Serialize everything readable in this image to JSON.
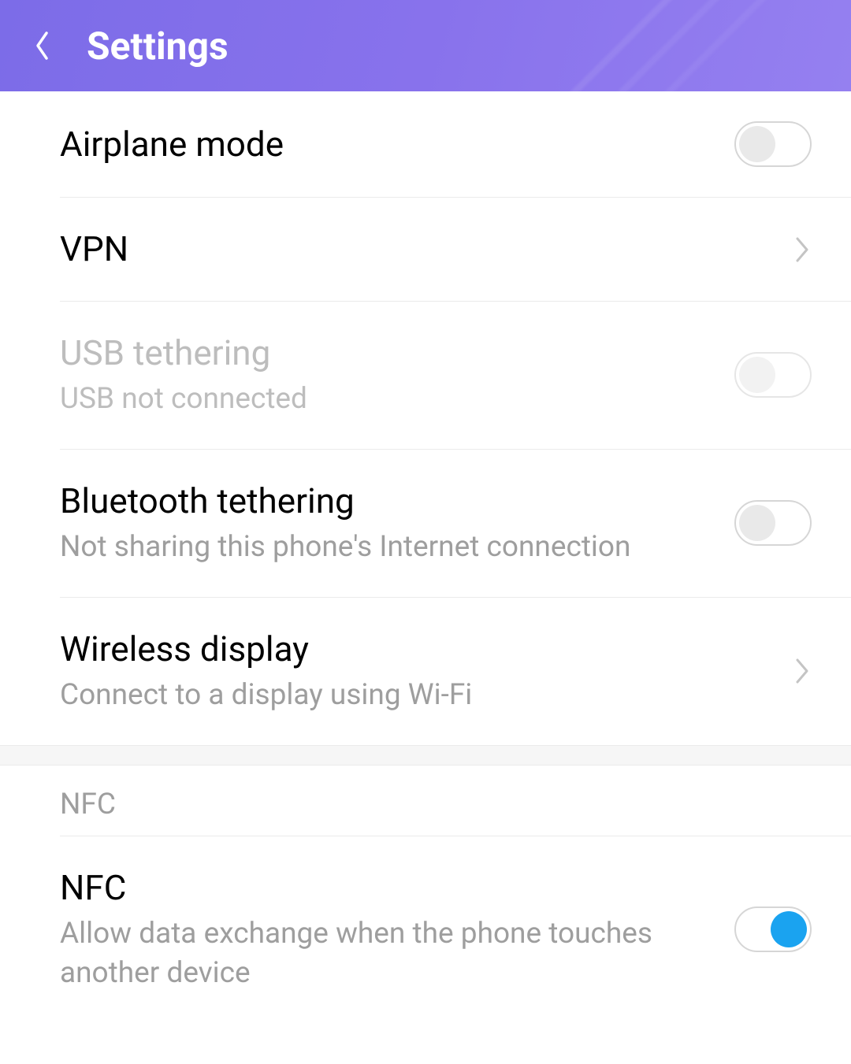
{
  "header": {
    "title": "Settings"
  },
  "rows": {
    "airplane": {
      "title": "Airplane mode"
    },
    "vpn": {
      "title": "VPN"
    },
    "usb": {
      "title": "USB tethering",
      "subtitle": "USB not connected"
    },
    "bluetooth": {
      "title": "Bluetooth tethering",
      "subtitle": "Not sharing this phone's Internet connection"
    },
    "wireless": {
      "title": "Wireless display",
      "subtitle": "Connect to a display using Wi-Fi"
    },
    "nfc": {
      "title": "NFC",
      "subtitle": "Allow data exchange when the phone touches another device"
    }
  },
  "section": {
    "nfc_header": "NFC"
  }
}
